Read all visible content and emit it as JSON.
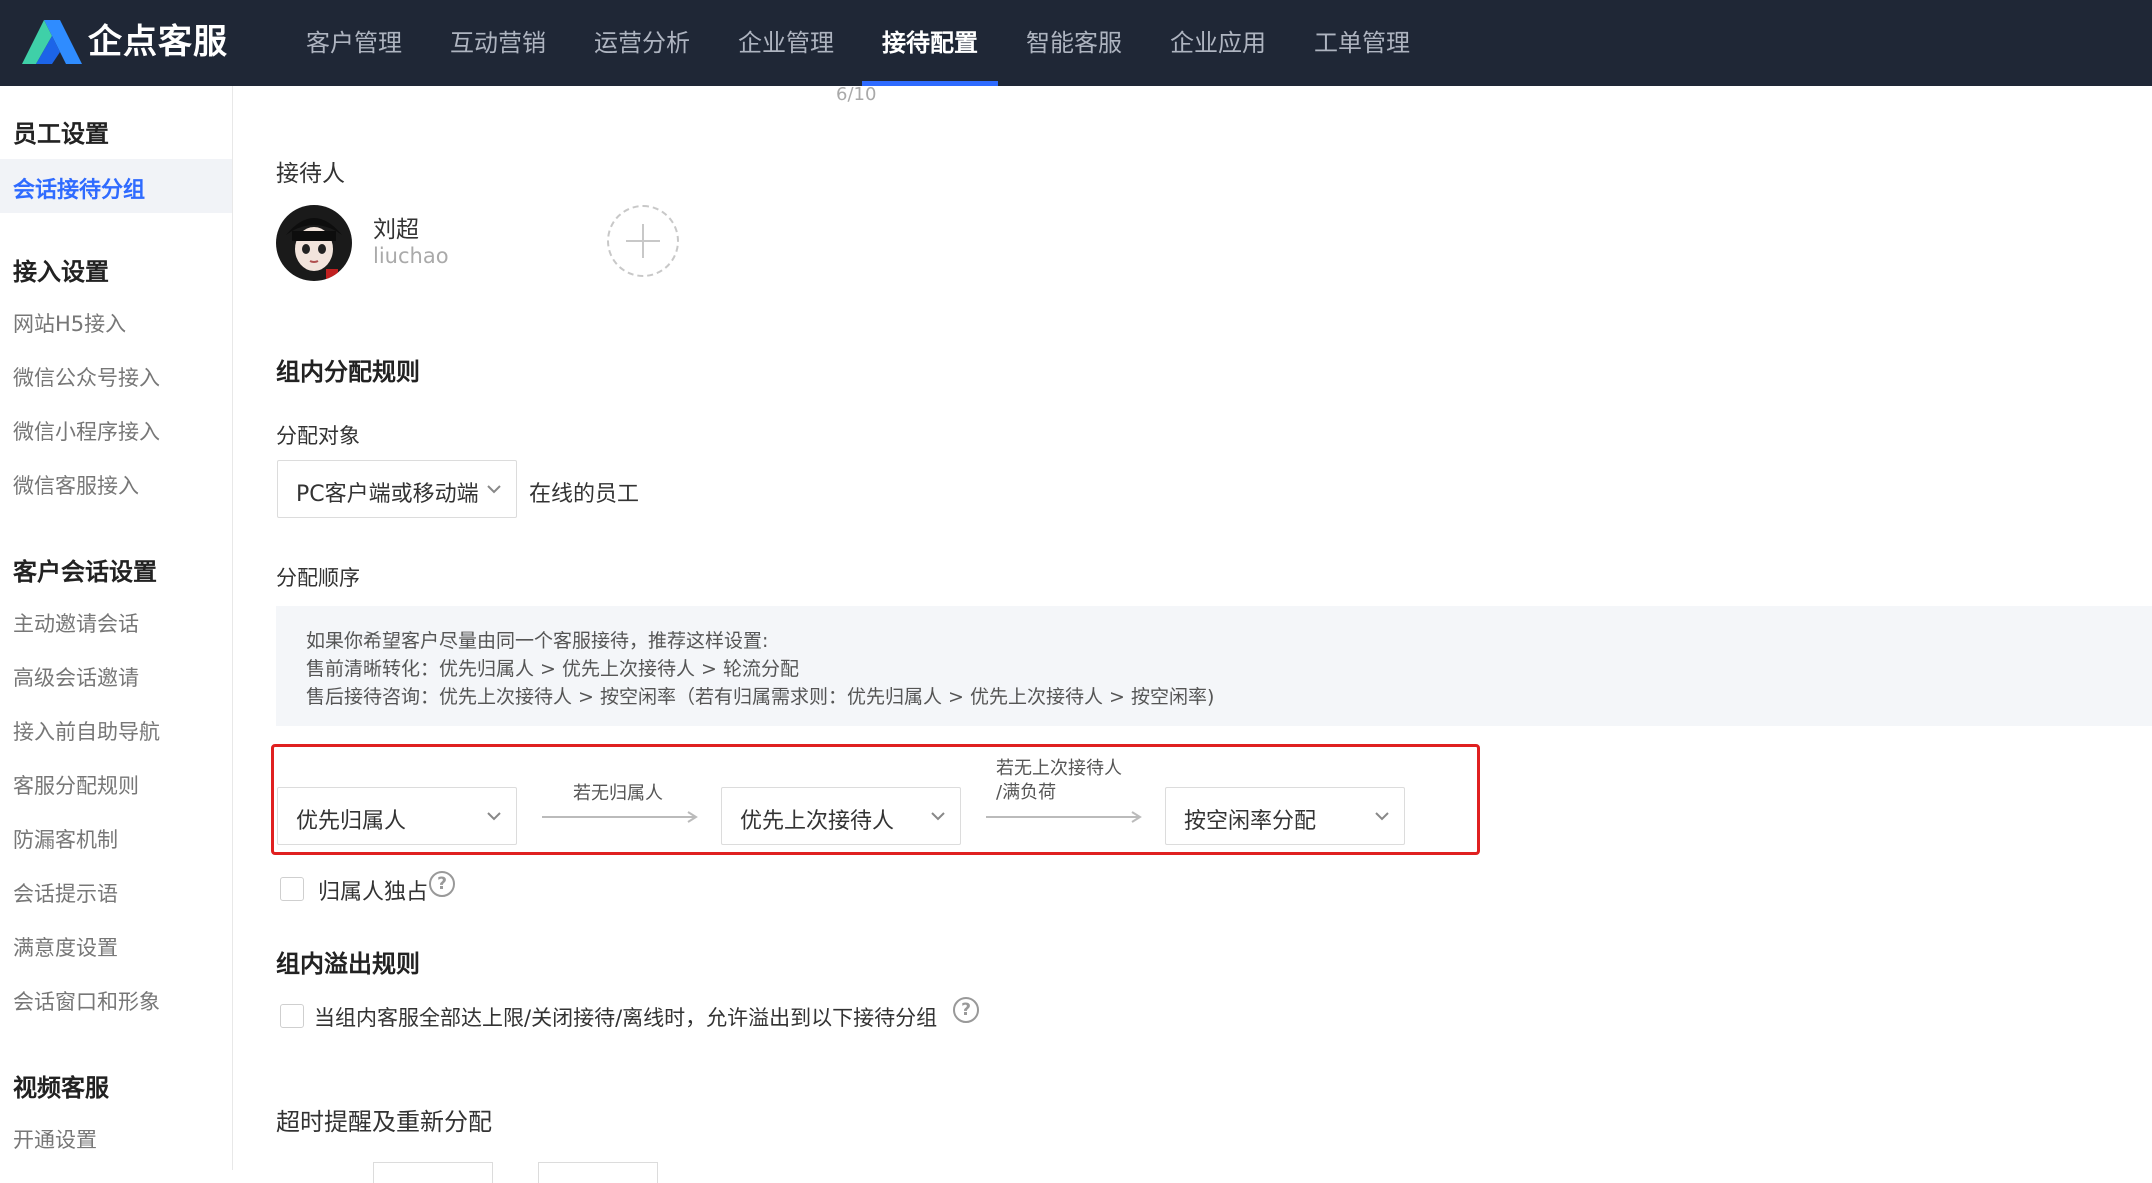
{
  "app": {
    "brand": "企点客服"
  },
  "nav": {
    "items": [
      "客户管理",
      "互动营销",
      "运营分析",
      "企业管理",
      "接待配置",
      "智能客服",
      "企业应用",
      "工单管理"
    ],
    "active": "接待配置"
  },
  "sidebar": {
    "groups": [
      {
        "title": "员工设置",
        "items": [
          "会话接待分组"
        ]
      },
      {
        "title": "接入设置",
        "items": [
          "网站H5接入",
          "微信公众号接入",
          "微信小程序接入",
          "微信客服接入"
        ]
      },
      {
        "title": "客户会话设置",
        "items": [
          "主动邀请会话",
          "高级会话邀请",
          "接入前自助导航",
          "客服分配规则",
          "防漏客机制",
          "会话提示语",
          "满意度设置",
          "会话窗口和形象"
        ]
      },
      {
        "title": "视频客服",
        "items": [
          "开通设置"
        ]
      }
    ],
    "active_item": "会话接待分组"
  },
  "main": {
    "counter": "6/10",
    "reception": {
      "label": "接待人",
      "agent": {
        "name": "刘超",
        "id": "liuchao"
      }
    },
    "distribution_rules": {
      "title": "组内分配规则",
      "target_label": "分配对象",
      "target_select": "PC客户端或移动端",
      "target_suffix": "在线的员工",
      "order_label": "分配顺序",
      "info_lines": [
        "如果你希望客户尽量由同一个客服接待，推荐这样设置:",
        "售前清晰转化：优先归属人 > 优先上次接待人 > 轮流分配",
        "售后接待咨询：优先上次接待人 > 按空闲率（若有归属需求则：优先归属人 > 优先上次接待人 > 按空闲率)"
      ],
      "step1": "优先归属人",
      "arrow1_label": "若无归属人",
      "step2": "优先上次接待人",
      "arrow2_label_line1": "若无上次接待人",
      "arrow2_label_line2": "/满负荷",
      "step3": "按空闲率分配",
      "exclusive_label": "归属人独占"
    },
    "overflow_rules": {
      "title": "组内溢出规则",
      "checkbox_label": "当组内客服全部达上限/关闭接待/离线时，允许溢出到以下接待分组"
    },
    "timeout": {
      "title": "超时提醒及重新分配"
    }
  },
  "colors": {
    "accent": "#2f6bff",
    "topbar": "#1f2736",
    "highlight": "#e02020"
  }
}
